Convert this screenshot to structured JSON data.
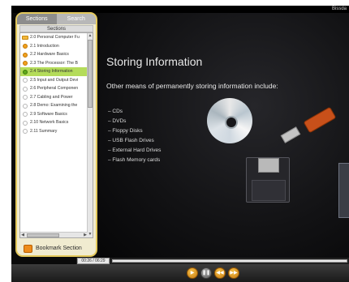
{
  "window": {
    "brand": "Bissda"
  },
  "sidebar": {
    "tabs": [
      {
        "label": "Sections",
        "active": true
      },
      {
        "label": "Search",
        "active": false
      }
    ],
    "header": "Sections",
    "items": [
      {
        "label": "2.0 Personal Computer Fu",
        "marker": "folder"
      },
      {
        "label": "2.1 Introduction",
        "marker": "orange"
      },
      {
        "label": "2.2 Hardware Basics",
        "marker": "orange"
      },
      {
        "label": "2.3 The Processor: The B",
        "marker": "orange"
      },
      {
        "label": "2.4 Storing Information",
        "marker": "green",
        "selected": true
      },
      {
        "label": "2.5 Input and Output Devi",
        "marker": "empty"
      },
      {
        "label": "2.6 Peripheral Componen",
        "marker": "empty"
      },
      {
        "label": "2.7 Cabling and Power",
        "marker": "empty"
      },
      {
        "label": "2.8 Demo: Examining the",
        "marker": "empty"
      },
      {
        "label": "2.9 Software Basics",
        "marker": "empty"
      },
      {
        "label": "2.10 Network Basics",
        "marker": "empty"
      },
      {
        "label": "2.11 Summary",
        "marker": "empty"
      }
    ],
    "bookmark_label": "Bookmark Section"
  },
  "slide": {
    "title": "Storing Information",
    "subtitle": "Other means of permanently storing information include:",
    "bullets": [
      "– CDs",
      "– DVDs",
      "– Floppy Disks",
      "– USB Flash Drives",
      "– External Hard Drives",
      "– Flash Memory cards"
    ]
  },
  "player": {
    "time": "00:26 / 06:29",
    "buttons": [
      "play-icon",
      "pause-icon",
      "rewind-icon",
      "fast-forward-icon"
    ]
  },
  "colors": {
    "sidebar_border": "#e4c95c",
    "selected_row": "#b4dc5a",
    "control_accent": "#f0a01e"
  }
}
